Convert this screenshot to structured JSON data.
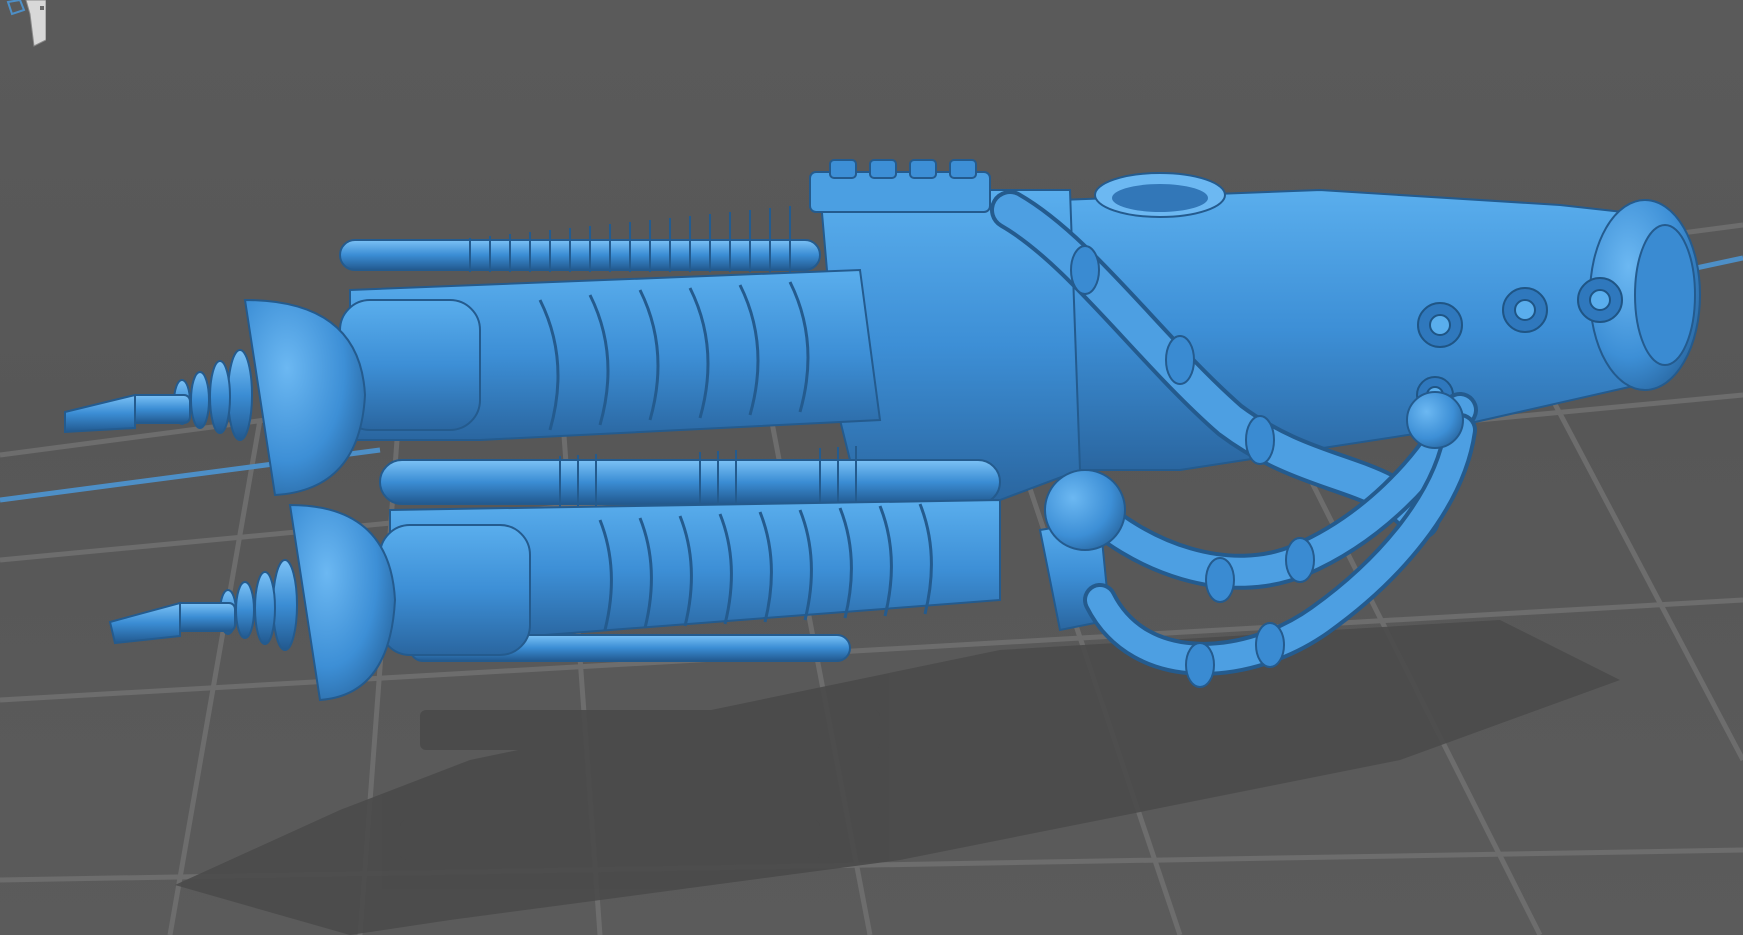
{
  "app": {
    "view": "3d-print-slicer-viewport"
  },
  "scene": {
    "background_color": "#585858",
    "grid_color": "#6e6e6e",
    "axis_color": "#4d8fc7",
    "model_color": "#3d8fd6",
    "model_shade_color": "#2b6aa6",
    "model_highlight_color": "#6bb5f0",
    "shadow_color": "#484848"
  },
  "icons": {
    "view_cube": "view-cube-icon"
  }
}
